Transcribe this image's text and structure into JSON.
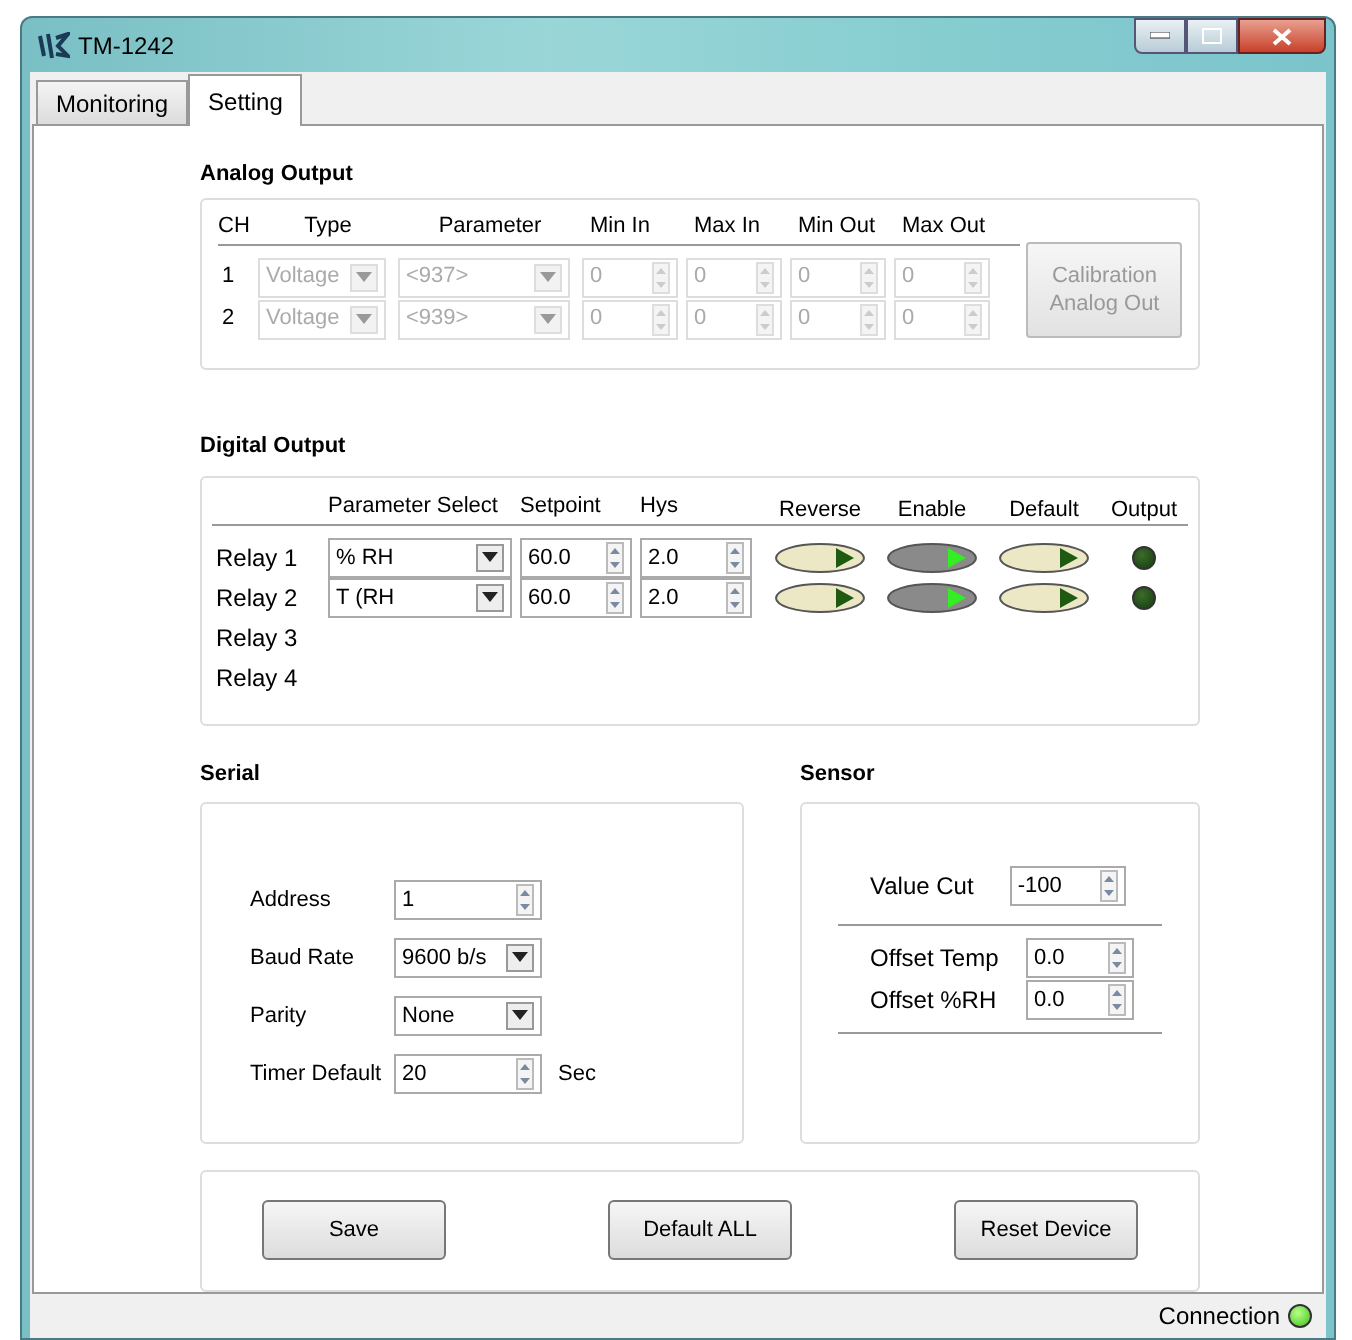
{
  "window": {
    "title": "TM-1242"
  },
  "tabs": [
    {
      "label": "Monitoring",
      "selected": false
    },
    {
      "label": "Setting",
      "selected": true
    }
  ],
  "analog_output": {
    "title": "Analog Output",
    "disabled": true,
    "columns": [
      "CH",
      "Type",
      "Parameter",
      "Min In",
      "Max In",
      "Min Out",
      "Max Out"
    ],
    "channels": [
      {
        "ch": "1",
        "type": "Voltage",
        "parameter": "<937>",
        "min_in": "0",
        "max_in": "0",
        "min_out": "0",
        "max_out": "0"
      },
      {
        "ch": "2",
        "type": "Voltage",
        "parameter": "<939>",
        "min_in": "0",
        "max_in": "0",
        "min_out": "0",
        "max_out": "0"
      }
    ],
    "calibration_button": "Calibration Analog Out"
  },
  "digital_output": {
    "title": "Digital Output",
    "columns": [
      "Parameter Select",
      "Setpoint",
      "Hys",
      "Reverse",
      "Enable",
      "Default",
      "Output"
    ],
    "relays": [
      {
        "name": "Relay 1",
        "parameter": "% RH",
        "setpoint": "60.0",
        "hys": "2.0",
        "reverse": false,
        "enable": true,
        "default": false,
        "output": false
      },
      {
        "name": "Relay 2",
        "parameter": "T (RH",
        "setpoint": "60.0",
        "hys": "2.0",
        "reverse": false,
        "enable": true,
        "default": false,
        "output": false
      },
      {
        "name": "Relay 3"
      },
      {
        "name": "Relay 4"
      }
    ]
  },
  "serial": {
    "title": "Serial",
    "fields": [
      {
        "kind": "spin",
        "label": "Address",
        "value": "1"
      },
      {
        "kind": "dropdown",
        "label": "Baud Rate",
        "value": "9600 b/s"
      },
      {
        "kind": "dropdown",
        "label": "Parity",
        "value": "None"
      },
      {
        "kind": "spin",
        "label": "Timer Default",
        "value": "20",
        "unit": "Sec"
      }
    ]
  },
  "sensor": {
    "title": "Sensor",
    "value_cut": {
      "label": "Value Cut",
      "value": "-100"
    },
    "offsets": [
      {
        "label": "Offset Temp",
        "value": "0.0"
      },
      {
        "label": "Offset %RH",
        "value": "0.0"
      }
    ]
  },
  "buttons": [
    "Save",
    "Default ALL",
    "Reset Device"
  ],
  "status_bar": {
    "label": "Connection",
    "connected": true
  }
}
